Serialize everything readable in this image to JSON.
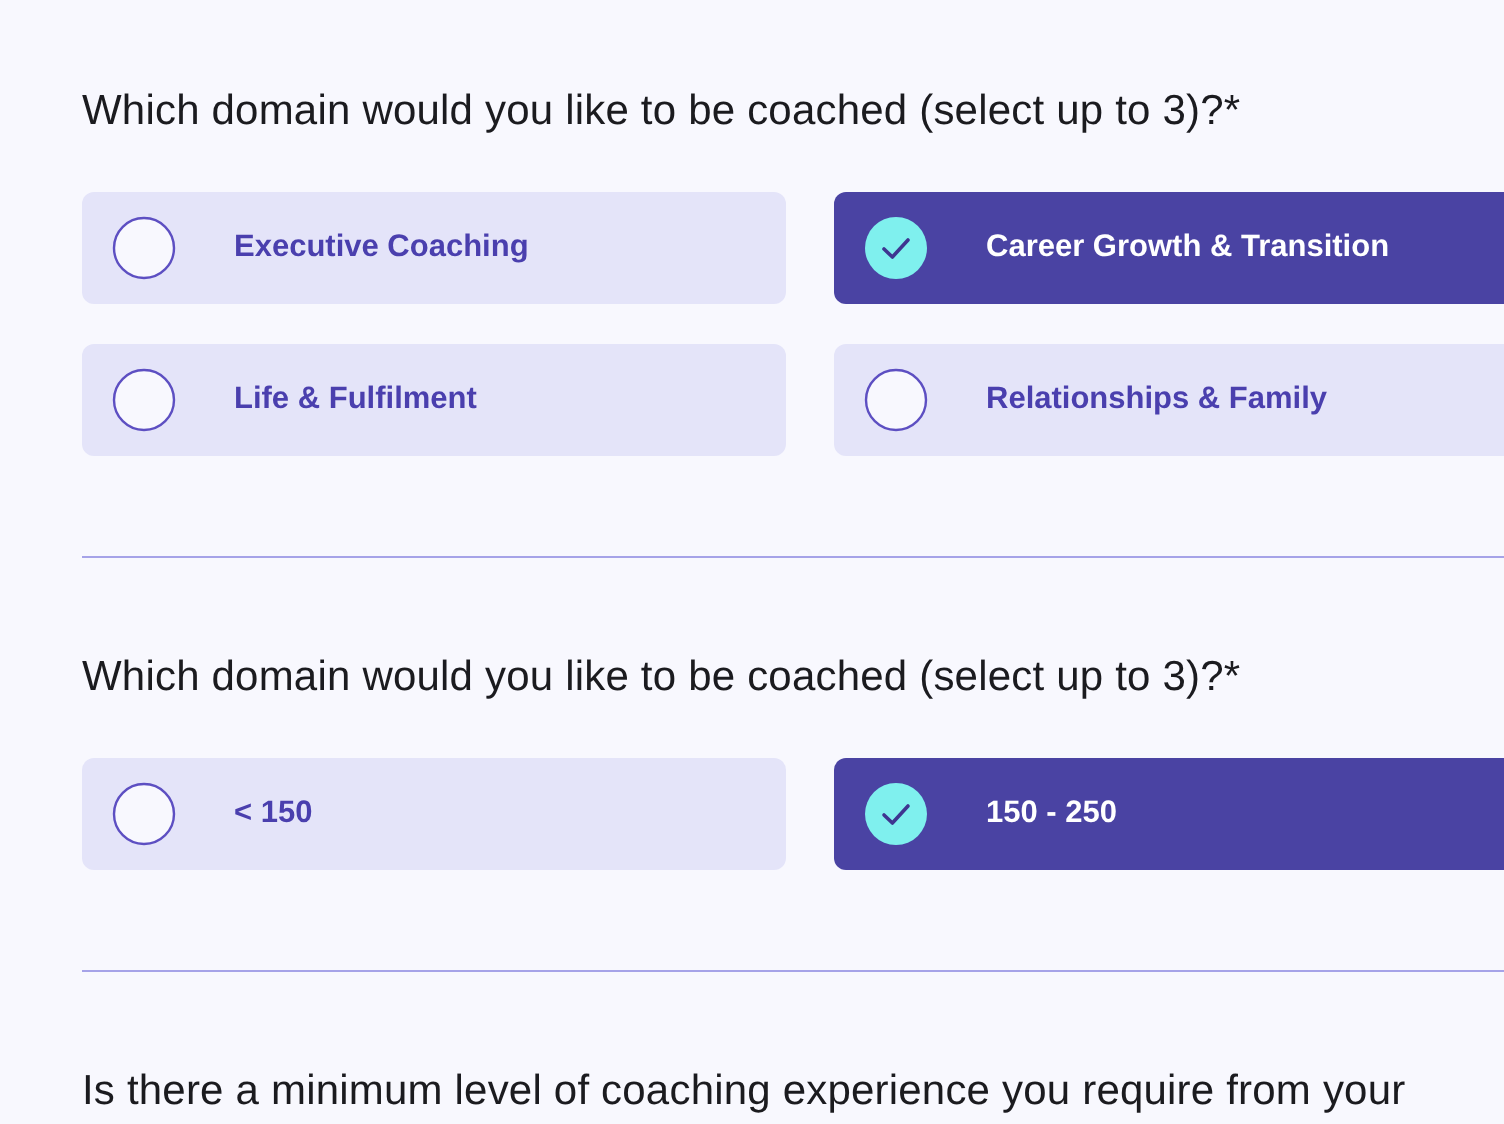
{
  "questions": [
    {
      "prompt": "Which domain would you like to be coached (select up to 3)?*",
      "options": [
        {
          "label": "Executive Coaching",
          "selected": false
        },
        {
          "label": "Career Growth & Transition",
          "selected": true
        },
        {
          "label": "Life & Fulfilment",
          "selected": false
        },
        {
          "label": "Relationships & Family",
          "selected": false
        }
      ]
    },
    {
      "prompt": "Which domain would you like to be coached (select up to 3)?*",
      "options": [
        {
          "label": "< 150",
          "selected": false
        },
        {
          "label": "150 - 250",
          "selected": true
        }
      ]
    },
    {
      "prompt": "Is there a minimum level of coaching experience you require from your"
    }
  ]
}
